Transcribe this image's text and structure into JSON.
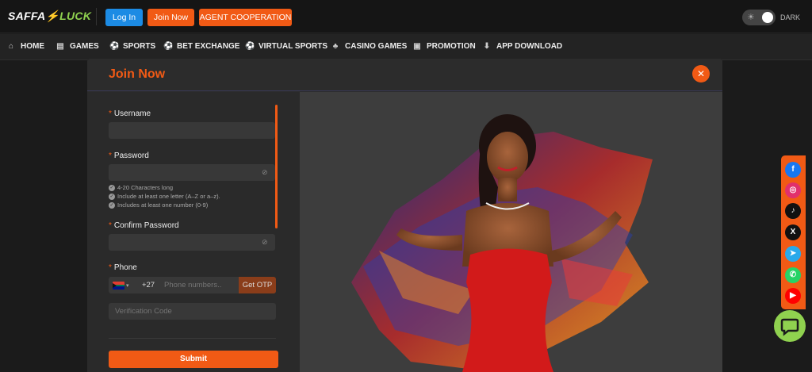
{
  "header": {
    "logo_part1": "SAFFA",
    "logo_bolt": "⚡",
    "logo_part2": "LUCK",
    "login_label": "Log In",
    "join_label": "Join Now",
    "agent_label": "AGENT COOPERATION",
    "theme_label": "DARK"
  },
  "nav": [
    {
      "label": "HOME",
      "icon": "home-icon",
      "glyph": "⌂"
    },
    {
      "label": "GAMES",
      "icon": "games-icon",
      "glyph": "▤"
    },
    {
      "label": "SPORTS",
      "icon": "sports-ball-icon",
      "glyph": "⚽"
    },
    {
      "label": "BET EXCHANGE",
      "icon": "bet-exchange-icon",
      "glyph": "⚽"
    },
    {
      "label": "VIRTUAL SPORTS",
      "icon": "virtual-sports-icon",
      "glyph": "⚽"
    },
    {
      "label": "CASINO GAMES",
      "icon": "casino-icon",
      "glyph": "♣"
    },
    {
      "label": "PROMOTION",
      "icon": "gift-icon",
      "glyph": "▣"
    },
    {
      "label": "APP DOWNLOAD",
      "icon": "download-icon",
      "glyph": "⬇"
    }
  ],
  "modal": {
    "title": "Join Now",
    "close_glyph": "✕",
    "username_label": "Username",
    "password_label": "Password",
    "password_rules": [
      "4-20 Characters long",
      "Include at least one letter (A–Z or a–z).",
      "Includes at least one number (0-9)"
    ],
    "confirm_label": "Confirm Password",
    "phone_label": "Phone",
    "country_code": "+27",
    "phone_placeholder": "Phone numbers..",
    "otp_label": "Get OTP",
    "verification_placeholder": "Verification Code",
    "submit_label": "Submit",
    "required_mark": "*"
  },
  "social": [
    {
      "name": "facebook-icon",
      "glyph": "f",
      "color": "#1877f2"
    },
    {
      "name": "instagram-icon",
      "glyph": "◎",
      "color": "#e1306c"
    },
    {
      "name": "tiktok-icon",
      "glyph": "♪",
      "color": "#111111"
    },
    {
      "name": "x-icon",
      "glyph": "X",
      "color": "#111111"
    },
    {
      "name": "telegram-icon",
      "glyph": "➤",
      "color": "#29a9eb"
    },
    {
      "name": "whatsapp-icon",
      "glyph": "✆",
      "color": "#25d366"
    },
    {
      "name": "youtube-icon",
      "glyph": "▶",
      "color": "#ff0000"
    }
  ],
  "colors": {
    "accent": "#f15a15",
    "login_blue": "#1c8be4",
    "chat_green": "#8fd14f"
  }
}
